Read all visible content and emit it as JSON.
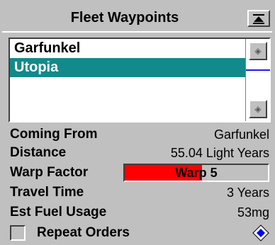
{
  "header": {
    "title": "Fleet Waypoints"
  },
  "waypoints": [
    {
      "label": "Garfunkel",
      "selected": false
    },
    {
      "label": "Utopia",
      "selected": true
    }
  ],
  "details": {
    "coming_from": {
      "label": "Coming From",
      "value": "Garfunkel"
    },
    "distance": {
      "label": "Distance",
      "value": "55.04 Light Years"
    },
    "warp_factor": {
      "label": "Warp Factor",
      "value": "Warp 5",
      "fill_fraction": 0.54,
      "color": "#ff0000"
    },
    "travel_time": {
      "label": "Travel Time",
      "value": "3 Years"
    },
    "fuel": {
      "label": "Est Fuel Usage",
      "value": "53mg"
    }
  },
  "repeat_orders": {
    "label": "Repeat Orders",
    "checked": false
  },
  "colors": {
    "selection": "#138a8a",
    "marker": "#1a1aff"
  },
  "icons": {
    "collapse": "collapse-up-icon",
    "scroll_up": "scroll-up-icon",
    "scroll_down": "scroll-down-icon",
    "diamond": "blue-diamond-icon"
  }
}
